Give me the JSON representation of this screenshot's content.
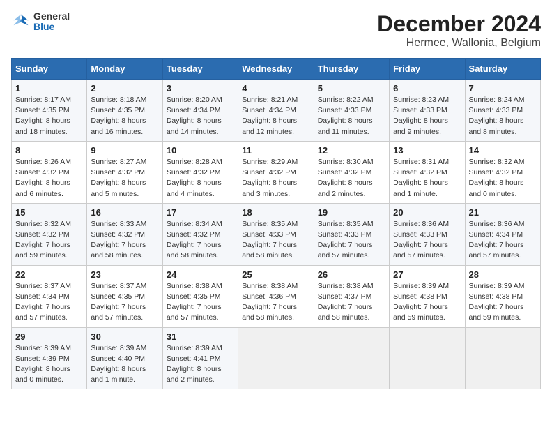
{
  "header": {
    "logo_line1": "General",
    "logo_line2": "Blue",
    "title": "December 2024",
    "subtitle": "Hermee, Wallonia, Belgium"
  },
  "days_of_week": [
    "Sunday",
    "Monday",
    "Tuesday",
    "Wednesday",
    "Thursday",
    "Friday",
    "Saturday"
  ],
  "weeks": [
    [
      {
        "day": 1,
        "sunrise": "8:17 AM",
        "sunset": "4:35 PM",
        "daylight": "8 hours and 18 minutes."
      },
      {
        "day": 2,
        "sunrise": "8:18 AM",
        "sunset": "4:35 PM",
        "daylight": "8 hours and 16 minutes."
      },
      {
        "day": 3,
        "sunrise": "8:20 AM",
        "sunset": "4:34 PM",
        "daylight": "8 hours and 14 minutes."
      },
      {
        "day": 4,
        "sunrise": "8:21 AM",
        "sunset": "4:34 PM",
        "daylight": "8 hours and 12 minutes."
      },
      {
        "day": 5,
        "sunrise": "8:22 AM",
        "sunset": "4:33 PM",
        "daylight": "8 hours and 11 minutes."
      },
      {
        "day": 6,
        "sunrise": "8:23 AM",
        "sunset": "4:33 PM",
        "daylight": "8 hours and 9 minutes."
      },
      {
        "day": 7,
        "sunrise": "8:24 AM",
        "sunset": "4:33 PM",
        "daylight": "8 hours and 8 minutes."
      }
    ],
    [
      {
        "day": 8,
        "sunrise": "8:26 AM",
        "sunset": "4:32 PM",
        "daylight": "8 hours and 6 minutes."
      },
      {
        "day": 9,
        "sunrise": "8:27 AM",
        "sunset": "4:32 PM",
        "daylight": "8 hours and 5 minutes."
      },
      {
        "day": 10,
        "sunrise": "8:28 AM",
        "sunset": "4:32 PM",
        "daylight": "8 hours and 4 minutes."
      },
      {
        "day": 11,
        "sunrise": "8:29 AM",
        "sunset": "4:32 PM",
        "daylight": "8 hours and 3 minutes."
      },
      {
        "day": 12,
        "sunrise": "8:30 AM",
        "sunset": "4:32 PM",
        "daylight": "8 hours and 2 minutes."
      },
      {
        "day": 13,
        "sunrise": "8:31 AM",
        "sunset": "4:32 PM",
        "daylight": "8 hours and 1 minute."
      },
      {
        "day": 14,
        "sunrise": "8:32 AM",
        "sunset": "4:32 PM",
        "daylight": "8 hours and 0 minutes."
      }
    ],
    [
      {
        "day": 15,
        "sunrise": "8:32 AM",
        "sunset": "4:32 PM",
        "daylight": "7 hours and 59 minutes."
      },
      {
        "day": 16,
        "sunrise": "8:33 AM",
        "sunset": "4:32 PM",
        "daylight": "7 hours and 58 minutes."
      },
      {
        "day": 17,
        "sunrise": "8:34 AM",
        "sunset": "4:32 PM",
        "daylight": "7 hours and 58 minutes."
      },
      {
        "day": 18,
        "sunrise": "8:35 AM",
        "sunset": "4:33 PM",
        "daylight": "7 hours and 58 minutes."
      },
      {
        "day": 19,
        "sunrise": "8:35 AM",
        "sunset": "4:33 PM",
        "daylight": "7 hours and 57 minutes."
      },
      {
        "day": 20,
        "sunrise": "8:36 AM",
        "sunset": "4:33 PM",
        "daylight": "7 hours and 57 minutes."
      },
      {
        "day": 21,
        "sunrise": "8:36 AM",
        "sunset": "4:34 PM",
        "daylight": "7 hours and 57 minutes."
      }
    ],
    [
      {
        "day": 22,
        "sunrise": "8:37 AM",
        "sunset": "4:34 PM",
        "daylight": "7 hours and 57 minutes."
      },
      {
        "day": 23,
        "sunrise": "8:37 AM",
        "sunset": "4:35 PM",
        "daylight": "7 hours and 57 minutes."
      },
      {
        "day": 24,
        "sunrise": "8:38 AM",
        "sunset": "4:35 PM",
        "daylight": "7 hours and 57 minutes."
      },
      {
        "day": 25,
        "sunrise": "8:38 AM",
        "sunset": "4:36 PM",
        "daylight": "7 hours and 58 minutes."
      },
      {
        "day": 26,
        "sunrise": "8:38 AM",
        "sunset": "4:37 PM",
        "daylight": "7 hours and 58 minutes."
      },
      {
        "day": 27,
        "sunrise": "8:39 AM",
        "sunset": "4:38 PM",
        "daylight": "7 hours and 59 minutes."
      },
      {
        "day": 28,
        "sunrise": "8:39 AM",
        "sunset": "4:38 PM",
        "daylight": "7 hours and 59 minutes."
      }
    ],
    [
      {
        "day": 29,
        "sunrise": "8:39 AM",
        "sunset": "4:39 PM",
        "daylight": "8 hours and 0 minutes."
      },
      {
        "day": 30,
        "sunrise": "8:39 AM",
        "sunset": "4:40 PM",
        "daylight": "8 hours and 1 minute."
      },
      {
        "day": 31,
        "sunrise": "8:39 AM",
        "sunset": "4:41 PM",
        "daylight": "8 hours and 2 minutes."
      },
      null,
      null,
      null,
      null
    ]
  ]
}
